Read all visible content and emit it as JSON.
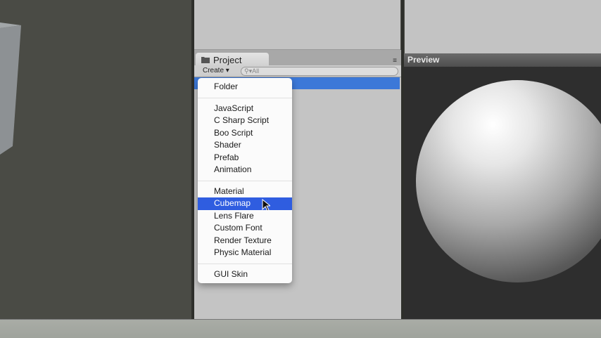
{
  "project_panel": {
    "tab_label": "Project",
    "create_label": "Create ▾",
    "search_placeholder": "All",
    "menu_icon": "≡"
  },
  "preview_panel": {
    "title": "Preview"
  },
  "create_menu": {
    "groups": [
      [
        "Folder"
      ],
      [
        "JavaScript",
        "C Sharp Script",
        "Boo Script",
        "Shader",
        "Prefab",
        "Animation"
      ],
      [
        "Material",
        "Cubemap",
        "Lens Flare",
        "Custom Font",
        "Render Texture",
        "Physic Material"
      ],
      [
        "GUI Skin"
      ]
    ],
    "highlighted": "Cubemap"
  },
  "colors": {
    "selection": "#3c78d8",
    "menu_highlight": "#2f5de0"
  }
}
